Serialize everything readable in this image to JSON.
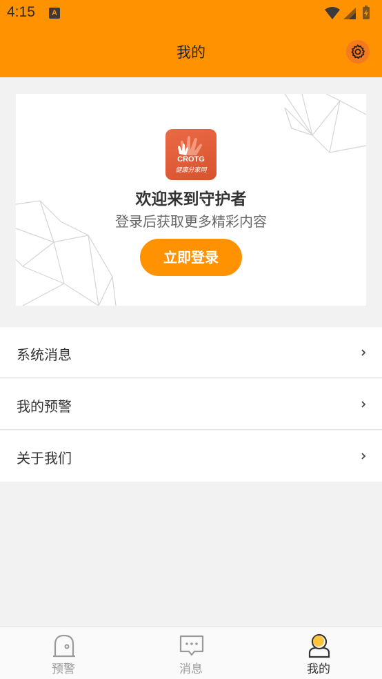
{
  "status_bar": {
    "time": "4:15",
    "notification_badge": "A"
  },
  "header": {
    "title": "我的",
    "settings_icon": "gear-icon"
  },
  "welcome_card": {
    "logo_text": "CROTG",
    "logo_subtext": "健康分家网",
    "heading": "欢迎来到守护者",
    "subtitle": "登录后获取更多精彩内容",
    "login_button": "立即登录"
  },
  "menu": [
    {
      "label": "系统消息",
      "icon": "chevron-right-icon"
    },
    {
      "label": "我的预警",
      "icon": "chevron-right-icon"
    },
    {
      "label": "关于我们",
      "icon": "chevron-right-icon"
    }
  ],
  "tabs": [
    {
      "label": "预警",
      "icon": "alarm-icon",
      "active": false
    },
    {
      "label": "消息",
      "icon": "message-icon",
      "active": false
    },
    {
      "label": "我的",
      "icon": "profile-icon",
      "active": true
    }
  ],
  "colors": {
    "accent": "#ff9200",
    "background": "#f2f2f2",
    "card": "#ffffff"
  }
}
